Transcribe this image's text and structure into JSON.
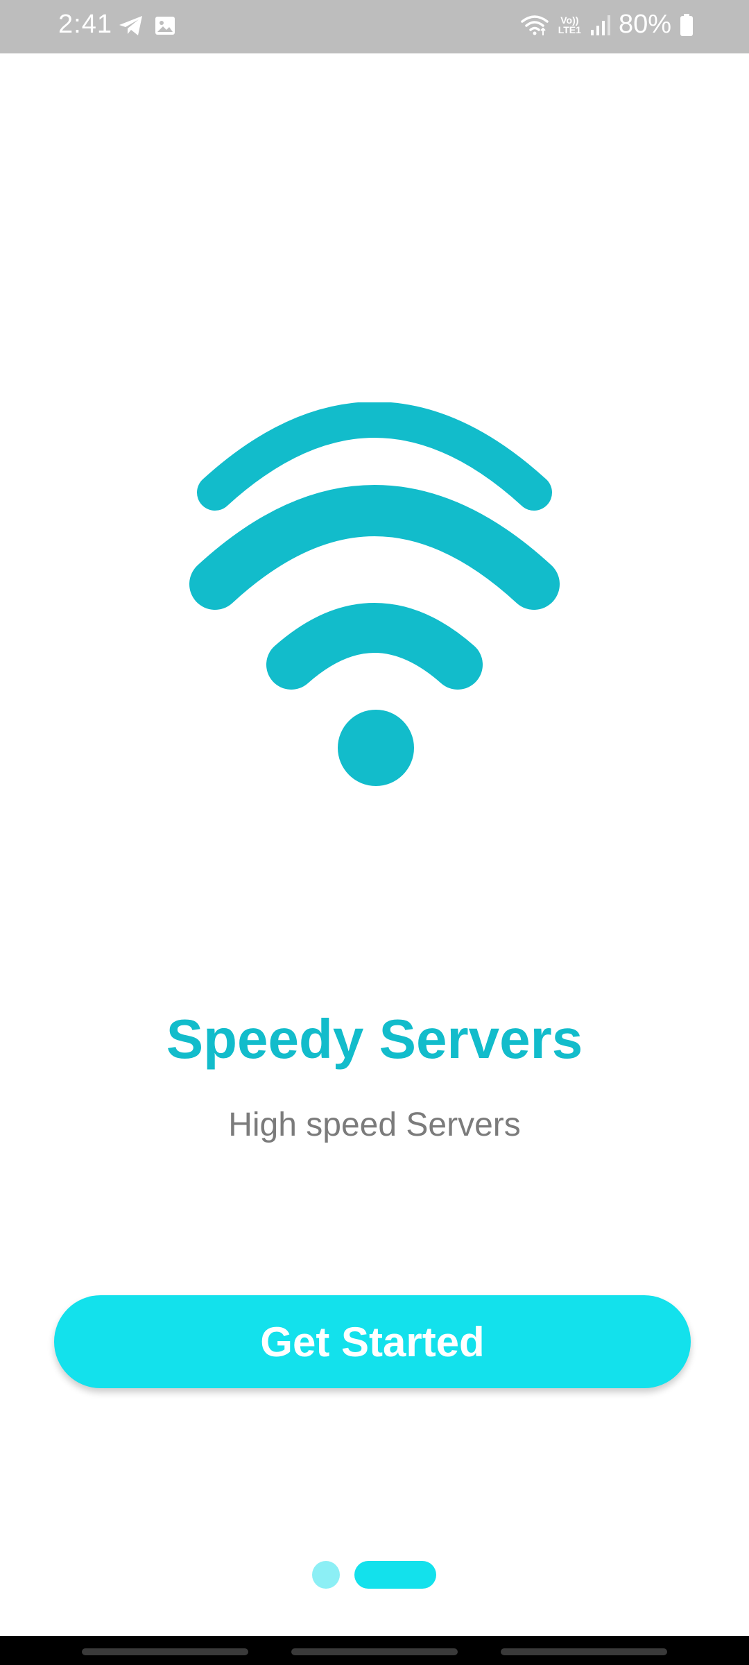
{
  "status_bar": {
    "time": "2:41",
    "lte_top": "Vo))",
    "lte_bottom": "LTE1",
    "battery_text": "80%",
    "icons": [
      "telegram-icon",
      "gallery-icon",
      "wifi-status-icon",
      "signal-icon",
      "battery-icon"
    ]
  },
  "onboarding": {
    "illustration": "wifi-icon",
    "title": "Speedy Servers",
    "subtitle": "High speed Servers",
    "cta_label": "Get Started",
    "page_indicator": {
      "total_pages": 2,
      "active_index": 1
    }
  },
  "colors": {
    "accent": "#12bccb",
    "button": "#13e1ec",
    "dot_inactive": "#8ceff5",
    "status_bar": "#bdbdbd",
    "subtitle": "#7b7b7b"
  }
}
